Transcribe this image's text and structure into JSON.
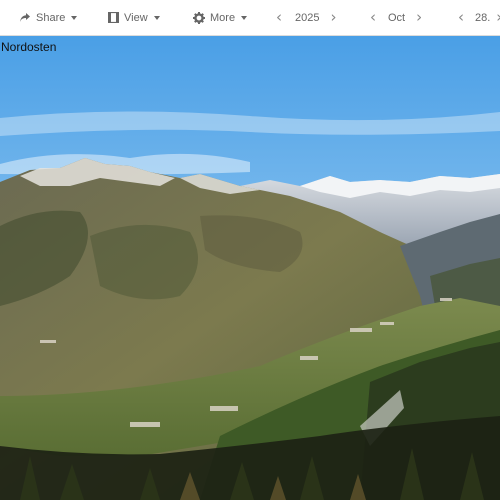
{
  "toolbar": {
    "share_label": "Share",
    "view_label": "View",
    "more_label": "More",
    "year": "2025",
    "month": "Oct",
    "day": "28."
  },
  "photo": {
    "caption": "Nordosten"
  },
  "colors": {
    "toolbar_bg": "#ffffff",
    "toolbar_text": "#666666",
    "sky_top": "#4a9fe6",
    "sky_bottom": "#b9dcf3"
  },
  "icons": [
    "share-icon",
    "view-icon",
    "gear-icon",
    "chevron-left-icon",
    "chevron-right-icon",
    "caret-down-icon"
  ]
}
